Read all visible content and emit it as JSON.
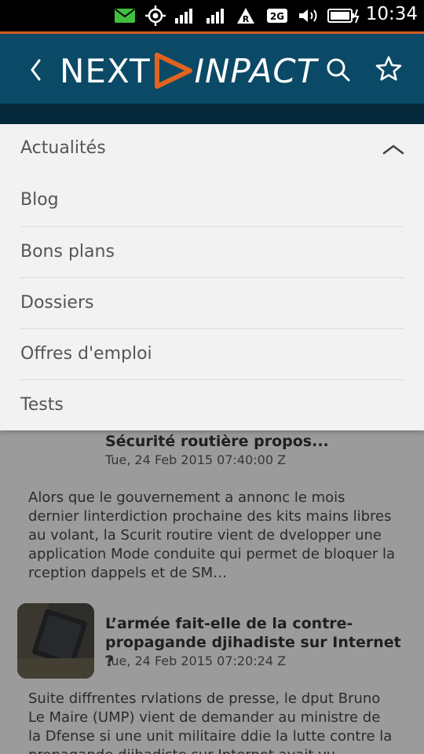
{
  "status_bar": {
    "time": "10:34",
    "icons": [
      "message-icon",
      "gps-icon",
      "signal-1-icon",
      "signal-2-icon",
      "roaming-icon",
      "network-2g-icon",
      "volume-icon",
      "battery-charging-icon"
    ],
    "roaming_label": "R",
    "network_label": "2G"
  },
  "header": {
    "logo_left": "NEXT",
    "logo_right": "INPACT",
    "accent_color": "#0b4a66",
    "brand_orange": "#e0631f"
  },
  "menu": {
    "selected": "Actualités",
    "items": [
      "Blog",
      "Bons plans",
      "Dossiers",
      "Offres d'emploi",
      "Tests"
    ]
  },
  "articles": [
    {
      "title": "Sécurité routière propos...",
      "date": "Tue, 24 Feb 2015 07:40:00 Z",
      "body": "Alors que le gouvernement a annonc le mois dernier linterdiction prochaine des kits mains libres au volant, la Scurit routire vient de dvelopper une application  Mode conduite  qui permet de bloquer la rception dappels et de SM…"
    },
    {
      "title": "L’armée fait-elle de la contre-propagande djihadiste sur Internet ?",
      "date": "Tue, 24 Feb 2015 07:20:24 Z",
      "body": "Suite  diffrentes rvlations de presse, le dput Bruno Le Maire (UMP) vient de demander au ministre de la Dfense si une unit militaire ddie  la lutte contre la propagande djihadiste sur Internet avait vu"
    }
  ]
}
